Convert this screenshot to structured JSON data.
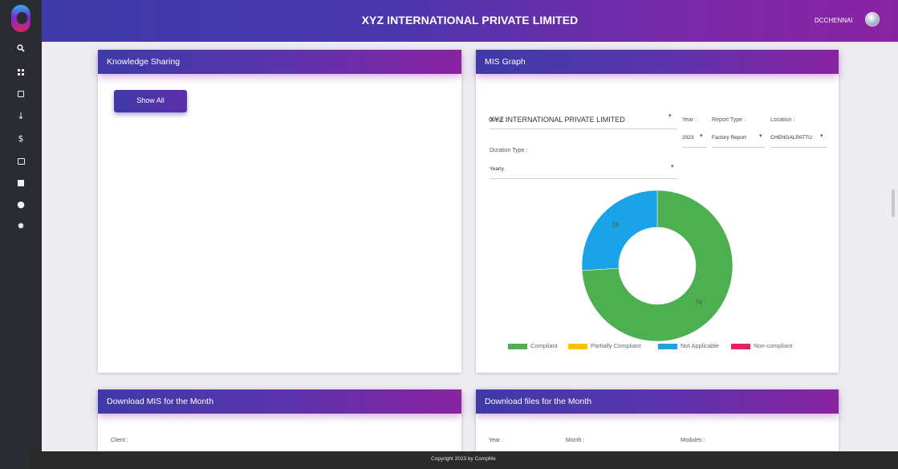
{
  "header": {
    "title": "XYZ INTERNATIONAL PRIVATE LIMITED",
    "user": "DCCHENNAI"
  },
  "sidebar": {
    "icons": [
      "search-icon",
      "dashboard-icon",
      "calendar-icon",
      "download-icon",
      "dollar-icon",
      "cast-icon",
      "report-icon",
      "user-circle-icon",
      "settings-icon"
    ]
  },
  "knowledge": {
    "title": "Knowledge Sharing",
    "show_all": "Show All"
  },
  "mis_graph": {
    "title": "MIS Graph",
    "client_label": "Client :",
    "client_value": "XYZ INTERNATIONAL PRIVATE LIMITED",
    "year_label": "Year :",
    "year_value": "2023",
    "report_type_label": "Report Type :",
    "report_type_value": "Factory Report",
    "location_label": "Location :",
    "location_value": "CHENGALPATTU",
    "duration_label": "Duration Type :",
    "duration_value": "Yearly"
  },
  "chart_data": {
    "type": "pie",
    "donut": true,
    "categories": [
      "Compliant",
      "Partially Compliant",
      "Not Applicable",
      "Non-compliant"
    ],
    "values": [
      74,
      0,
      26,
      0
    ],
    "colors": [
      "#4caf50",
      "#ffc107",
      "#1ba3e8",
      "#e91e63"
    ],
    "data_labels": [
      "74",
      "0",
      "26",
      "0"
    ],
    "legend_position": "bottom"
  },
  "download_mis": {
    "title": "Download MIS for the Month",
    "client_label": "Client :"
  },
  "download_files": {
    "title": "Download files for the Month",
    "year_label": "Year :",
    "month_label": "Month :",
    "modules_label": "Modules :"
  },
  "footer": {
    "text": "Copyright 2023 by CompMe"
  }
}
